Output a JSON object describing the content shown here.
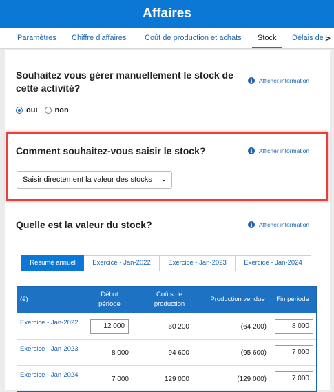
{
  "header": {
    "title": "Affaires"
  },
  "tabs": [
    {
      "label": "Paramètres",
      "active": false
    },
    {
      "label": "Chiffre d'affaires",
      "active": false
    },
    {
      "label": "Coût de production et achats",
      "active": false
    },
    {
      "label": "Stock",
      "active": true
    },
    {
      "label": "Délais de",
      "active": false
    }
  ],
  "q1": {
    "title": "Souhaitez vous gérer manuellement le stock de cette activité?",
    "info": "Afficher information",
    "options": [
      {
        "label": "oui",
        "checked": true
      },
      {
        "label": "non",
        "checked": false
      }
    ]
  },
  "q2": {
    "title": "Comment souhaitez-vous saisir le stock?",
    "info": "Afficher information",
    "select_value": "Saisir directement la valeur des stocks"
  },
  "q3": {
    "title": "Quelle est la valeur du stock?",
    "info": "Afficher information",
    "tabs": [
      {
        "label": "Résumé annuel",
        "active": true
      },
      {
        "label": "Exercice - Jan-2022",
        "active": false
      },
      {
        "label": "Exercice - Jan-2023",
        "active": false
      },
      {
        "label": "Exercice - Jan-2024",
        "active": false
      }
    ]
  },
  "table": {
    "headers": {
      "unit": "(€)",
      "debut": "Début période",
      "couts": "Coûts de production",
      "production": "Production vendue",
      "fin": "Fin période"
    },
    "rows": [
      {
        "label": "Exercice - Jan-2022",
        "debut": "12 000",
        "couts": "60 200",
        "production": "(64 200)",
        "fin": "8 000"
      },
      {
        "label": "Exercice - Jan-2023",
        "debut": "8 000",
        "couts": "94 600",
        "production": "(95 600)",
        "fin": "7 000"
      },
      {
        "label": "Exercice - Jan-2024",
        "debut": "7 000",
        "couts": "129 000",
        "production": "(129 000)",
        "fin": "7 000"
      }
    ]
  },
  "colors": {
    "brand": "#0b78d6",
    "link": "#1d64b0",
    "highlight": "#e5403b"
  }
}
